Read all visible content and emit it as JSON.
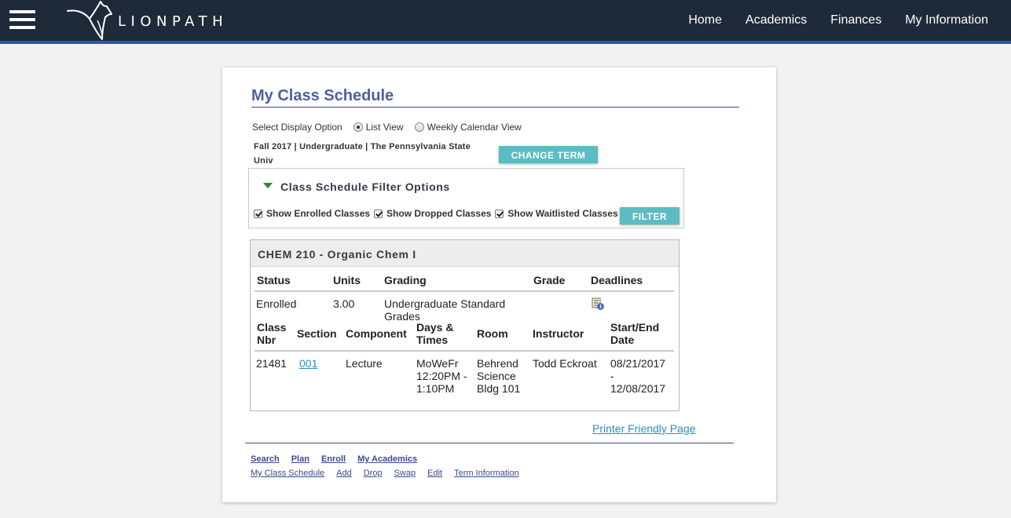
{
  "header": {
    "logo_text": "LIONPATH",
    "nav": {
      "home": "Home",
      "academics": "Academics",
      "finances": "Finances",
      "my_information": "My Information"
    },
    "colors": {
      "bar": "#1e2a3a",
      "accent": "#1f5fa8"
    }
  },
  "page": {
    "title": "My Class Schedule",
    "display_option_label": "Select Display Option",
    "list_view_label": "List View",
    "weekly_view_label": "Weekly Calendar View",
    "selected_view": "List View",
    "term_line1": "Fall 2017 | Undergraduate | The Pennsylvania State",
    "term_line2": "Univ",
    "change_term_button": "CHANGE TERM"
  },
  "filter": {
    "heading": "Class Schedule Filter Options",
    "show_enrolled": "Show Enrolled Classes",
    "show_dropped": "Show Dropped Classes",
    "show_waitlisted": "Show Waitlisted Classes",
    "enrolled_checked": true,
    "dropped_checked": true,
    "waitlisted_checked": true,
    "filter_button": "FILTER"
  },
  "class": {
    "title": "CHEM 210 - Organic Chem I",
    "summary_headers": {
      "status": "Status",
      "units": "Units",
      "grading": "Grading",
      "grade": "Grade",
      "deadlines": "Deadlines"
    },
    "summary_row": {
      "status": "Enrolled",
      "units": "3.00",
      "grading_line1": "Undergraduate Standard",
      "grading_line2": "Grades",
      "grade": "",
      "deadlines_icon": "calendar-info-icon"
    },
    "section_headers": {
      "class_nbr_1": "Class",
      "class_nbr_2": "Nbr",
      "section": "Section",
      "component": "Component",
      "days_times_1": "Days &",
      "days_times_2": "Times",
      "room": "Room",
      "instructor": "Instructor",
      "start_end_1": "Start/End",
      "start_end_2": "Date"
    },
    "section_row": {
      "class_nbr": "21481",
      "section": "001",
      "component": "Lecture",
      "days_1": "MoWeFr",
      "days_2": "12:20PM -",
      "days_3": "1:10PM",
      "room_1": "Behrend",
      "room_2": "Science",
      "room_3": "Bldg 101",
      "instructor": "Todd Eckroat",
      "date_1": "08/21/2017",
      "date_2": "-",
      "date_3": "12/08/2017"
    }
  },
  "footer": {
    "printer_friendly": "Printer Friendly Page",
    "nav": [
      "Search",
      "Plan",
      "Enroll",
      "My Academics"
    ],
    "sub_nav": [
      "My Class Schedule",
      "Add",
      "Drop",
      "Swap",
      "Edit",
      "Term Information"
    ]
  }
}
